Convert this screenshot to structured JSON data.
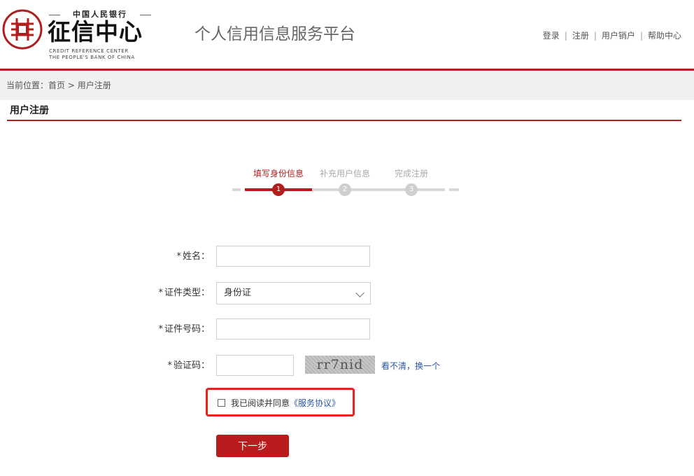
{
  "header": {
    "logo": {
      "bank_name": "中国人民银行",
      "center_name": "征信中心",
      "english_line1": "CREDIT REFERENCE CENTER",
      "english_line2": "THE PEOPLE'S BANK OF CHINA"
    },
    "platform_title": "个人信用信息服务平台",
    "nav": {
      "login": "登录",
      "register": "注册",
      "cancel_account": "用户销户",
      "help": "帮助中心",
      "separator": "|"
    }
  },
  "breadcrumb": {
    "prefix": "当前位置：",
    "home": "首页",
    "separator": ">",
    "current": "用户注册"
  },
  "section_title": "用户注册",
  "steps": [
    {
      "label": "填写身份信息",
      "number": "1",
      "state": "active"
    },
    {
      "label": "补充用户信息",
      "number": "2",
      "state": "inactive"
    },
    {
      "label": "完成注册",
      "number": "3",
      "state": "inactive"
    }
  ],
  "form": {
    "required_mark": "*",
    "name_label": "姓名：",
    "name_value": "",
    "id_type_label": "证件类型：",
    "id_type_value": "身份证",
    "id_number_label": "证件号码：",
    "id_number_value": "",
    "captcha_label": "验证码：",
    "captcha_value": "",
    "captcha_text": "rr7nid",
    "captcha_refresh": "看不清，换一个"
  },
  "agreement": {
    "text": "我已阅读并同意",
    "link": "《服务协议》",
    "checked": false
  },
  "next_button": "下一步",
  "colors": {
    "brand_red": "#b01e1e",
    "highlight_red": "#e0261f",
    "link_blue": "#2c56a5",
    "inactive_gray": "#cfcfcf"
  }
}
